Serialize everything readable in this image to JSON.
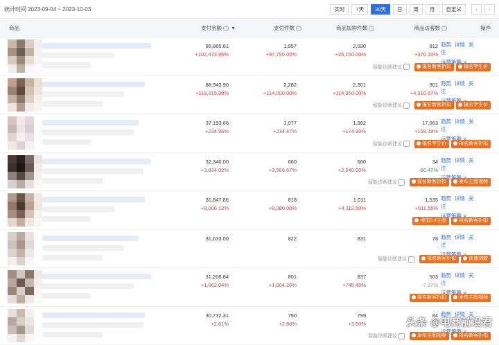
{
  "toolbar": {
    "date_range": "统计时间 2023-09-04 ~ 2023-10-03",
    "buttons": [
      "实时",
      "7天",
      "30天",
      "日",
      "周",
      "月",
      "自定义"
    ],
    "active": "30天",
    "prev": "‹",
    "next": "›"
  },
  "table": {
    "headers": {
      "product": "商品",
      "pay_amount": "支付金额",
      "pay_count": "支付件数",
      "cart_count": "商品加购件数",
      "visitors": "商品访客数",
      "ops": "操作"
    },
    "sort_icon": "▼",
    "help_glyph": "?",
    "op_labels": {
      "trend": "趋势",
      "detail": "详情",
      "follow": "关注",
      "strategy": "运营策略 ∨"
    },
    "diag_label": "智能诊断建议",
    "rows": [
      {
        "pay_amount": "95,865.61",
        "pay_amount_d": "+102,473.95%",
        "pay_count": "1,957",
        "pay_count_d": "+97,750.00%",
        "cart": "2,020",
        "cart_d": "+25,150.00%",
        "visitors": "912",
        "visitors_d": "+370.10%",
        "btn1": "报名新客折扣",
        "btn2": "报名学生价",
        "show_diag": true
      },
      {
        "pay_amount": "88,943.90",
        "pay_amount_d": "+119,015.98%",
        "pay_count": "2,282",
        "pay_count_d": "+114,000.00%",
        "cart": "2,301",
        "cart_d": "+114,950.00%",
        "visitors": "301",
        "visitors_d": "+4,916.67%",
        "btn1": "报名新客折扣",
        "btn2": "报名学生价",
        "show_diag": true
      },
      {
        "pay_amount": "37,193.66",
        "pay_amount_d": "+234.96%",
        "pay_count": "1,077",
        "pay_count_d": "+234.47%",
        "cart": "1,982",
        "cart_d": "+174.90%",
        "visitors": "17,063",
        "visitors_d": "+158.18%",
        "btn1": "报名学生价",
        "btn2": "报名新客折扣",
        "show_diag": true
      },
      {
        "pay_amount": "32,340.00",
        "pay_amount_d": "+3,834.02%",
        "pay_count": "660",
        "pay_count_d": "+3,566.67%",
        "cart": "660",
        "cart_d": "+2,540.00%",
        "visitors": "34",
        "visitors_d": "-60.47%",
        "visitors_dir": "down",
        "btn1": "报名新客折扣",
        "btn2": "发布主图视频",
        "show_diag": true
      },
      {
        "pay_amount": "31,847.86",
        "pay_amount_d": "+8,066.12%",
        "pay_count": "818",
        "pay_count_d": "+8,080.00%",
        "cart": "1,011",
        "cart_d": "+4,112.50%",
        "visitors": "1,535",
        "visitors_d": "+511.55%",
        "btn1": "增加3:4主图",
        "btn2": "报名新客折扣",
        "show_diag": false
      },
      {
        "pay_amount": "31,633.00",
        "pay_amount_d": "-",
        "pay_count": "822",
        "pay_count_d": "-",
        "cart": "831",
        "cart_d": "-",
        "visitors": "78",
        "visitors_d": "-",
        "btn1": "报名新客折扣",
        "btn2": "快速测款",
        "show_diag": true
      },
      {
        "pay_amount": "31,206.84",
        "pay_amount_d": "+1,662.04%",
        "pay_count": "801",
        "pay_count_d": "+1,604.26%",
        "cart": "837",
        "cart_d": "+745.45%",
        "visitors": "503",
        "visitors_d": "-7.37%",
        "visitors_dir": "flat",
        "btn1": "报名新客折扣",
        "btn2": "发布主图视频",
        "show_diag": false
      },
      {
        "pay_amount": "30,732.31",
        "pay_amount_d": "+2.61%",
        "pay_count": "790",
        "pay_count_d": "+2.86%",
        "cart": "799",
        "cart_d": "+3.50%",
        "visitors": "84",
        "visitors_d": "",
        "btn1": "发布主图视频",
        "btn2": "报名新客折扣",
        "show_diag": true
      }
    ]
  },
  "watermark": "头条 @电商前沿君",
  "colors": {
    "accent": "#2f6ee5",
    "up": "#e4393c",
    "down": "#1aa34a",
    "button": "#ef6c1a"
  }
}
